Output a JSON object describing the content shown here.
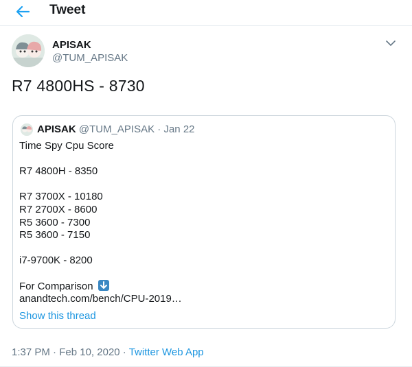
{
  "header": {
    "title": "Tweet",
    "back_icon": "back-arrow-icon",
    "accent": "#1da1f2"
  },
  "tweet": {
    "author_name": "APISAK",
    "author_handle": "@TUM_APISAK",
    "text": "R7 4800HS - 8730",
    "menu_icon": "chevron-down-icon"
  },
  "quote": {
    "author_name": "APISAK",
    "author_handle": "@TUM_APISAK",
    "separator": " · ",
    "date": "Jan 22",
    "lines": [
      "Time Spy Cpu Score",
      "R7 4800H - 8350",
      "R7 3700X - 10180",
      "R7 2700X - 8600",
      "R5 3600  - 7300",
      "R5 3600  - 7150",
      "i7-9700K - 8200",
      "For Comparison",
      "anandtech.com/bench/CPU-2019…"
    ],
    "emoji_icon": "down-arrow-emoji-icon",
    "show_thread": "Show this thread"
  },
  "footer": {
    "time": "1:37 PM",
    "separator": " · ",
    "date": "Feb 10, 2020",
    "source": "Twitter Web App"
  },
  "colors": {
    "text": "#14171a",
    "muted": "#657786",
    "link": "#1b95e0",
    "border": "#ccd6dd"
  }
}
